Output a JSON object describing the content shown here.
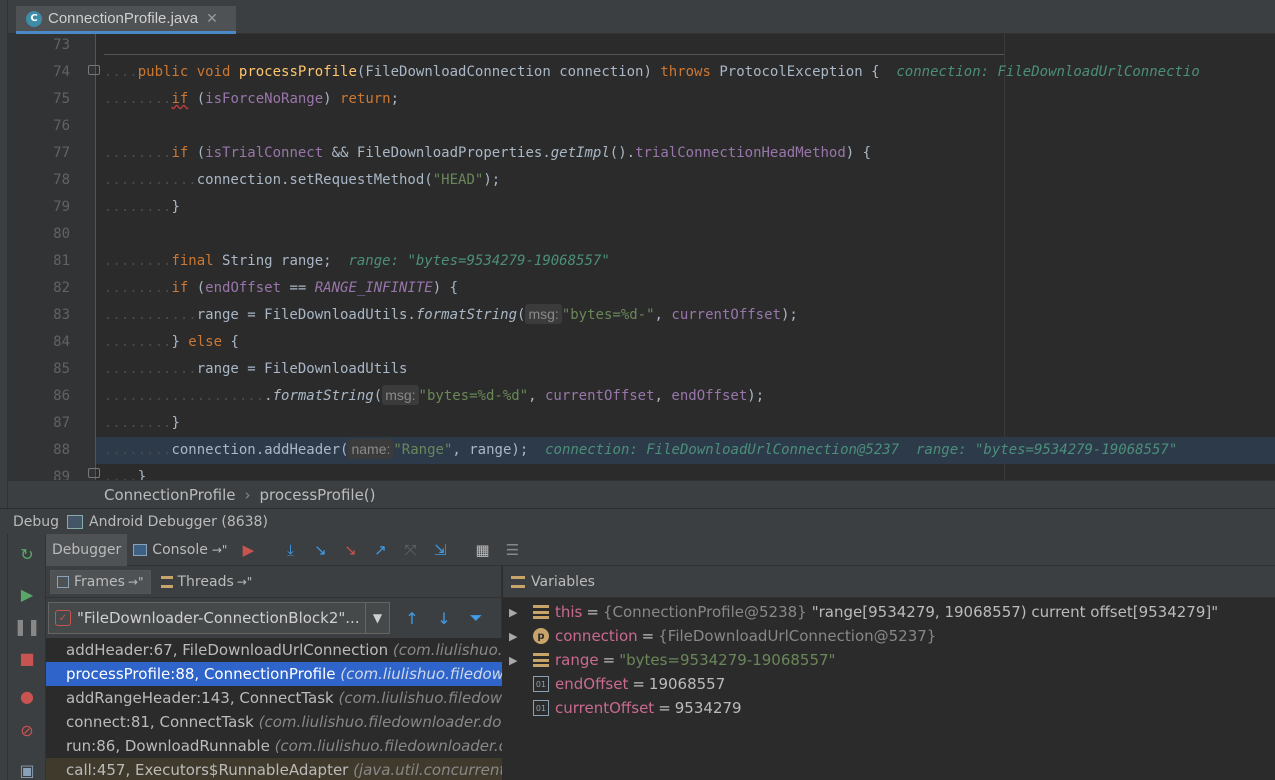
{
  "tab": {
    "file_name": "ConnectionProfile.java",
    "icon_letter": "C"
  },
  "editor": {
    "line_numbers": [
      "73",
      "74",
      "75",
      "76",
      "77",
      "78",
      "79",
      "80",
      "81",
      "82",
      "83",
      "84",
      "85",
      "86",
      "87",
      "88",
      "89"
    ],
    "hints": {
      "msg": "msg:",
      "name": "name:"
    },
    "inline_debug": {
      "line74": "connection: FileDownloadUrlConnectio",
      "line81": "range: \"bytes=9534279-19068557\"",
      "line88": "connection: FileDownloadUrlConnection@5237  range: \"bytes=9534279-19068557\""
    }
  },
  "breadcrumb": {
    "class_name": "ConnectionProfile",
    "method_name": "processProfile()"
  },
  "debug_header": {
    "label": "Debug",
    "config": "Android Debugger (8638)"
  },
  "debugger_tabs": {
    "debugger": "Debugger",
    "console": "Console",
    "console_suffix": "→\""
  },
  "frames_panel": {
    "frames_tab": "Frames",
    "threads_tab": "Threads",
    "tab_suffix": "→\"",
    "thread": "\"FileDownloader-ConnectionBlock2\"...",
    "frames": [
      {
        "method": "addHeader:67, FileDownloadUrlConnection",
        "pkg": "(com.liulishuo.fi"
      },
      {
        "method": "processProfile:88, ConnectionProfile",
        "pkg": "(com.liulishuo.filedown"
      },
      {
        "method": "addRangeHeader:143, ConnectTask",
        "pkg": "(com.liulishuo.filedown"
      },
      {
        "method": "connect:81, ConnectTask",
        "pkg": "(com.liulishuo.filedownloader.dow"
      },
      {
        "method": "run:86, DownloadRunnable",
        "pkg": "(com.liulishuo.filedownloader.do"
      },
      {
        "method": "call:457, Executors$RunnableAdapter",
        "pkg": "(java.util.concurrent)"
      }
    ]
  },
  "variables": {
    "title": "Variables",
    "items": [
      {
        "name": "this",
        "type": "{ConnectionProfile@5238}",
        "value": "\"range[9534279, 19068557) current offset[9534279]\""
      },
      {
        "name": "connection",
        "type": "{FileDownloadUrlConnection@5237}",
        "value": ""
      },
      {
        "name": "range",
        "type": "",
        "value": "\"bytes=9534279-19068557\""
      },
      {
        "name": "endOffset",
        "type": "",
        "value": "19068557"
      },
      {
        "name": "currentOffset",
        "type": "",
        "value": "9534279"
      }
    ]
  }
}
